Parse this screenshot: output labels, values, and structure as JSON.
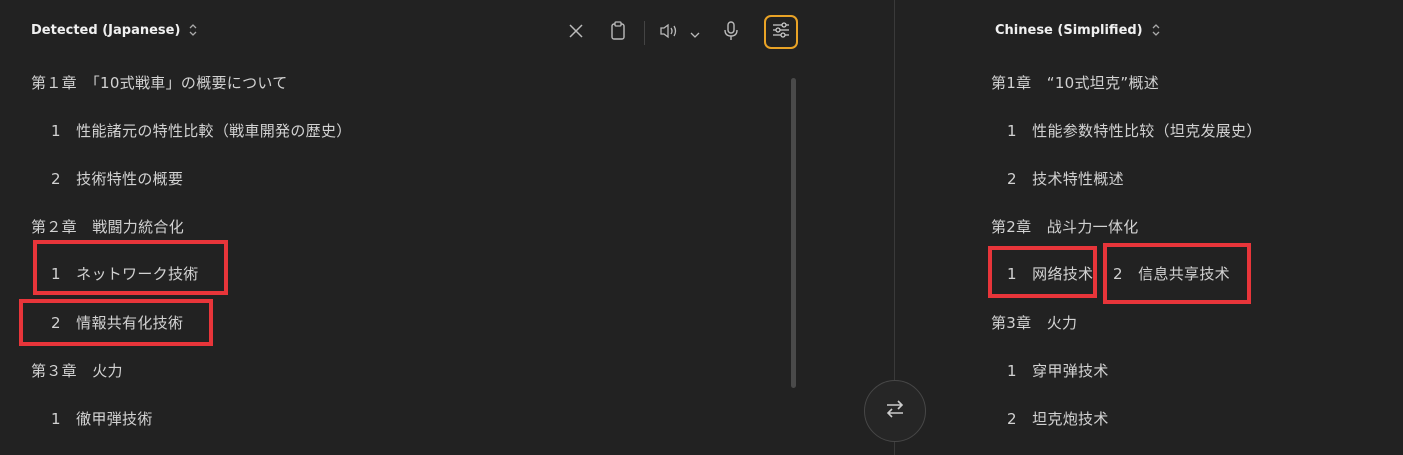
{
  "source": {
    "language_label": "Detected (Japanese)",
    "lines": [
      "第１章　「10式戦車」の概要について",
      "1　性能諸元の特性比較（戦車開発の歴史）",
      "2　技術特性の概要",
      "第２章　戦闘力統合化",
      "1　ネットワーク技術",
      "2　情報共有化技術",
      "第３章　火力",
      "1　徹甲弾技術"
    ]
  },
  "target": {
    "language_label": "Chinese (Simplified)",
    "lines": [
      "第1章　“10式坦克”概述",
      "1　性能参数特性比较（坦克发展史）",
      "2　技术特性概述",
      "第2章　战斗力一体化",
      "1　网络技术",
      "2　信息共享技术",
      "第3章　火力",
      "1　穿甲弹技术",
      "2　坦克炮技术"
    ]
  },
  "toolbar": {
    "icons": [
      "close-icon",
      "clipboard-icon",
      "speaker-icon",
      "chevron-down-icon",
      "microphone-icon",
      "settings-sliders-icon"
    ]
  },
  "swap": {
    "icon": "swap-arrows-icon"
  },
  "colors": {
    "background": "#222222",
    "text": "#d2d2d2",
    "accent": "#e9a326",
    "highlight": "#e8353a"
  }
}
